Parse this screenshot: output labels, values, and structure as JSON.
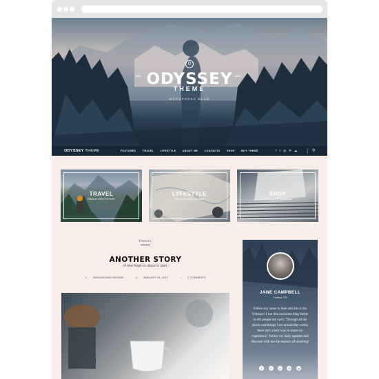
{
  "brand": {
    "title": "ODYSSEY",
    "subtitle": "THEME",
    "tagline": "WORDPRESS BLOG",
    "est_left": "EST",
    "est_right": "2017",
    "monogram": "O"
  },
  "nav": {
    "brand_bold": "ODYSSEY",
    "brand_rest": " THEME",
    "items": [
      "FEATURES",
      "TRAVEL",
      "LIFESTYLE",
      "ABOUT ME",
      "CONTACTS",
      "SHOP",
      "BUY THEME"
    ],
    "social": [
      "f",
      "t",
      "ig",
      "p",
      "sc"
    ],
    "search_icon": "search-icon"
  },
  "cards": [
    {
      "title": "TRAVEL",
      "subtitle": "Discover where I've been"
    },
    {
      "title": "LYFESTYLE",
      "subtitle": "Get my moments and habits"
    },
    {
      "title": "SHOP",
      "subtitle": "Take a look at my products"
    }
  ],
  "post": {
    "category": "TRAVEL",
    "title": "ANOTHER STORY",
    "subtitle": "- A new begin is about to start -",
    "author": "INDEXHOUND DESIGN",
    "date": "JANUARY 25, 2017",
    "comments": "2 COMMENTS"
  },
  "sidebar": {
    "name": "JANE CAMPBELL",
    "location": "Portland, OR",
    "bio": "Follow my name is Jane and this is my Odyssey! I use this awesome blog theme to tell people my story. Through all the places and things I see around the world, there isn't a best way to share my experience! Follow my daily updates and discover with me the essence of traveling!",
    "social": [
      "f",
      "t",
      "p",
      "ig",
      "sc"
    ]
  },
  "colors": {
    "nav_bg": "#172634",
    "content_bg": "#f8ede8",
    "accent": "#ffffff"
  }
}
